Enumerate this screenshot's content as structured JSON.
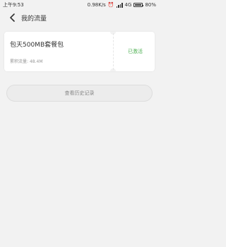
{
  "status_bar": {
    "time": "上午9:53",
    "network_speed": "0.98K/s",
    "network_type": "4G",
    "battery": "80%",
    "icons": [
      "network-speed",
      "alarm-icon",
      "signal-icon",
      "battery-icon"
    ]
  },
  "header": {
    "title": "我的流量",
    "back_icon": "chevron-left-icon"
  },
  "package_card": {
    "name": "包天500MB套餐包",
    "usage_label": "累积流量:",
    "usage_value": "48.4M",
    "status": "已激活"
  },
  "history_button": {
    "label": "查看历史记录"
  },
  "colors": {
    "background": "#f2f2f2",
    "card": "#ffffff",
    "status_active": "#4caf50",
    "muted_text": "#999999"
  }
}
